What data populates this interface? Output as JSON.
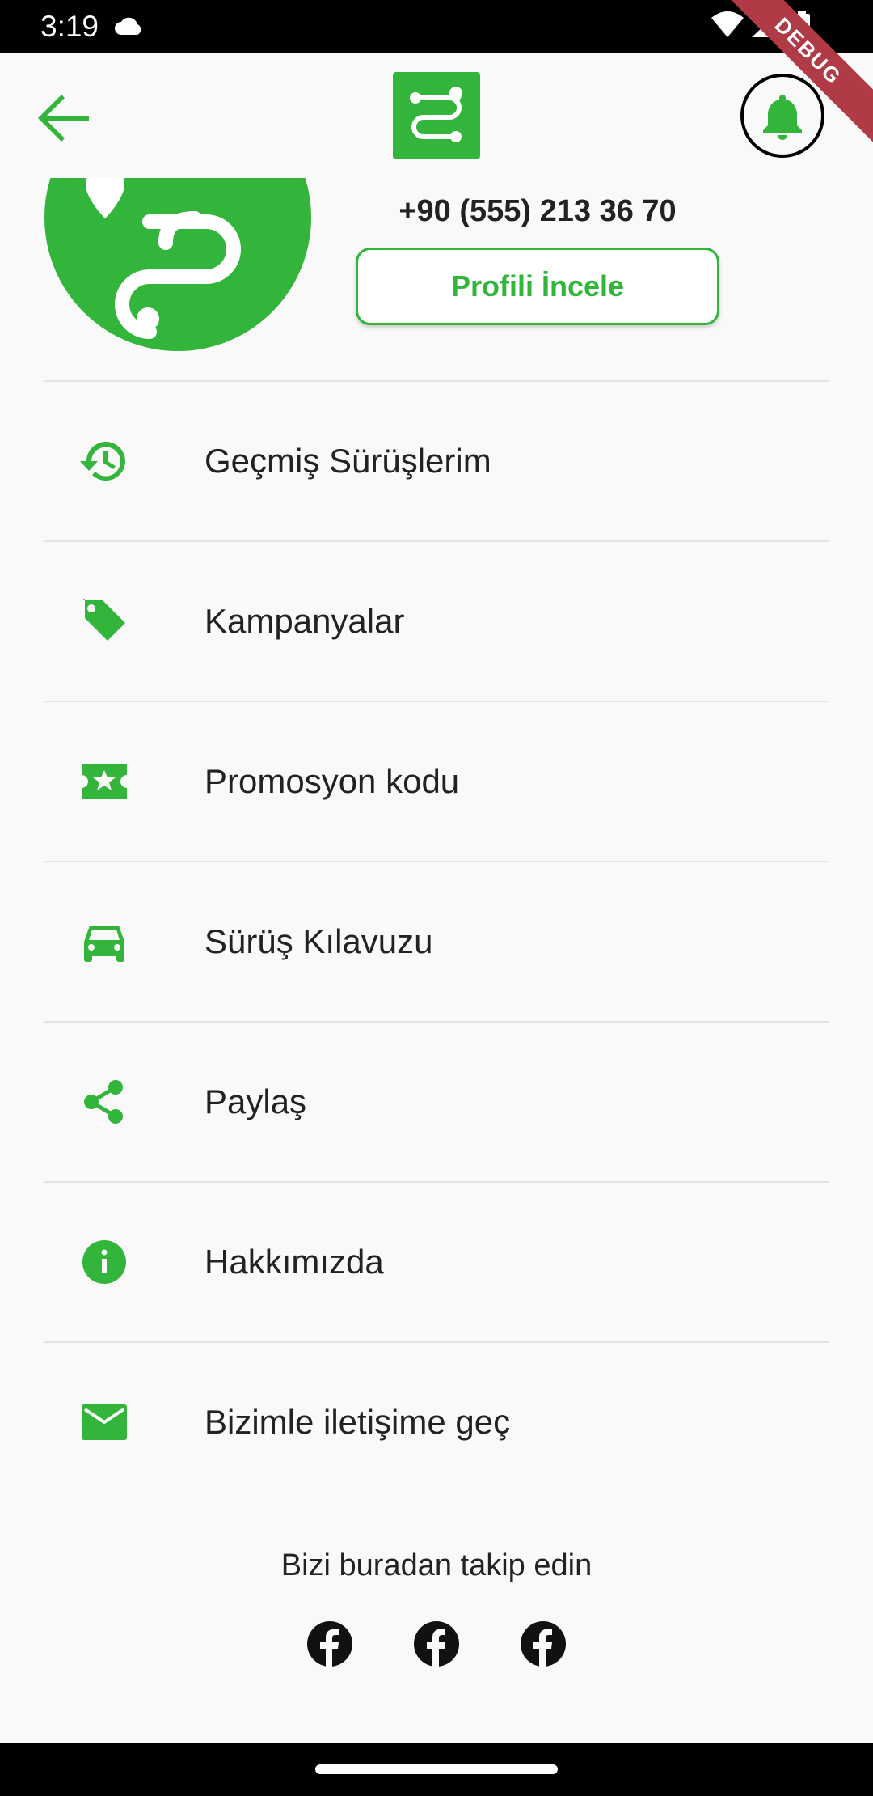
{
  "status_bar": {
    "time": "3:19",
    "icons": [
      "cloud-icon",
      "wifi-icon",
      "signal-icon",
      "battery-icon"
    ]
  },
  "debug_banner": "DEBUG",
  "app_bar": {
    "back_icon": "arrow-left-icon",
    "logo_icon": "route-logo-icon",
    "notification_icon": "bell-icon"
  },
  "profile": {
    "phone": "+90 (555) 213 36 70",
    "review_button": "Profili İncele"
  },
  "menu": [
    {
      "icon": "history-icon",
      "label": "Geçmiş Sürüşlerim"
    },
    {
      "icon": "tag-icon",
      "label": "Kampanyalar"
    },
    {
      "icon": "ticket-star-icon",
      "label": "Promosyon kodu"
    },
    {
      "icon": "car-icon",
      "label": "Sürüş Kılavuzu"
    },
    {
      "icon": "share-icon",
      "label": "Paylaş"
    },
    {
      "icon": "info-icon",
      "label": "Hakkımızda"
    },
    {
      "icon": "mail-icon",
      "label": "Bizimle iletişime geç"
    }
  ],
  "follow": {
    "title": "Bizi buradan takip edin",
    "socials": [
      "facebook-icon",
      "facebook-icon",
      "facebook-icon"
    ]
  },
  "colors": {
    "accent": "#32b53a",
    "text": "#222222",
    "background": "#f9f9f9",
    "debug": "#b03a46"
  }
}
